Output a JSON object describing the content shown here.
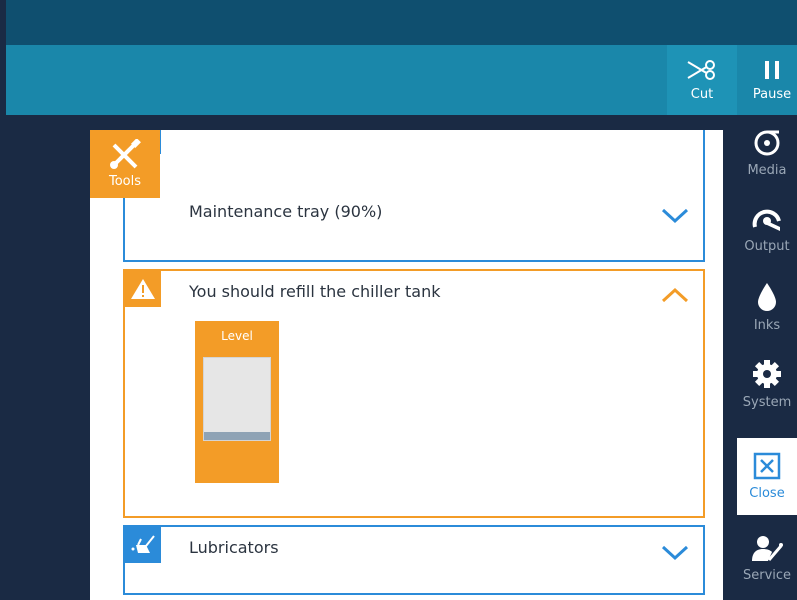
{
  "toolbar": {
    "cut_label": "Cut",
    "pause_label": "Pause"
  },
  "tools_tab": {
    "label": "Tools"
  },
  "right_nav": [
    {
      "label": "Media",
      "icon": "media-roll-icon",
      "active": false
    },
    {
      "label": "Output",
      "icon": "output-icon",
      "active": false
    },
    {
      "label": "Inks",
      "icon": "ink-drop-icon",
      "active": false
    },
    {
      "label": "System",
      "icon": "gear-icon",
      "active": false
    },
    {
      "label": "Close",
      "icon": "close-icon",
      "active": true
    },
    {
      "label": "Service",
      "icon": "service-icon",
      "active": false
    }
  ],
  "cards": [
    {
      "title": "Maintenance tray (90%)",
      "icon": "tray-icon",
      "state": "collapsed",
      "color": "#2b8bd9"
    },
    {
      "title": "You should refill the chiller tank",
      "icon": "warning-icon",
      "state": "expanded",
      "color": "#f39c27",
      "level": {
        "label": "Level",
        "fraction": 0.1
      }
    },
    {
      "title": "Lubricators",
      "icon": "oil-can-icon",
      "state": "collapsed",
      "color": "#2b8bd9"
    }
  ],
  "colors": {
    "accent_blue": "#2b8bd9",
    "warning_orange": "#f39c27",
    "toolbar_teal": "#1a87aa",
    "navy": "#1a2a44"
  }
}
